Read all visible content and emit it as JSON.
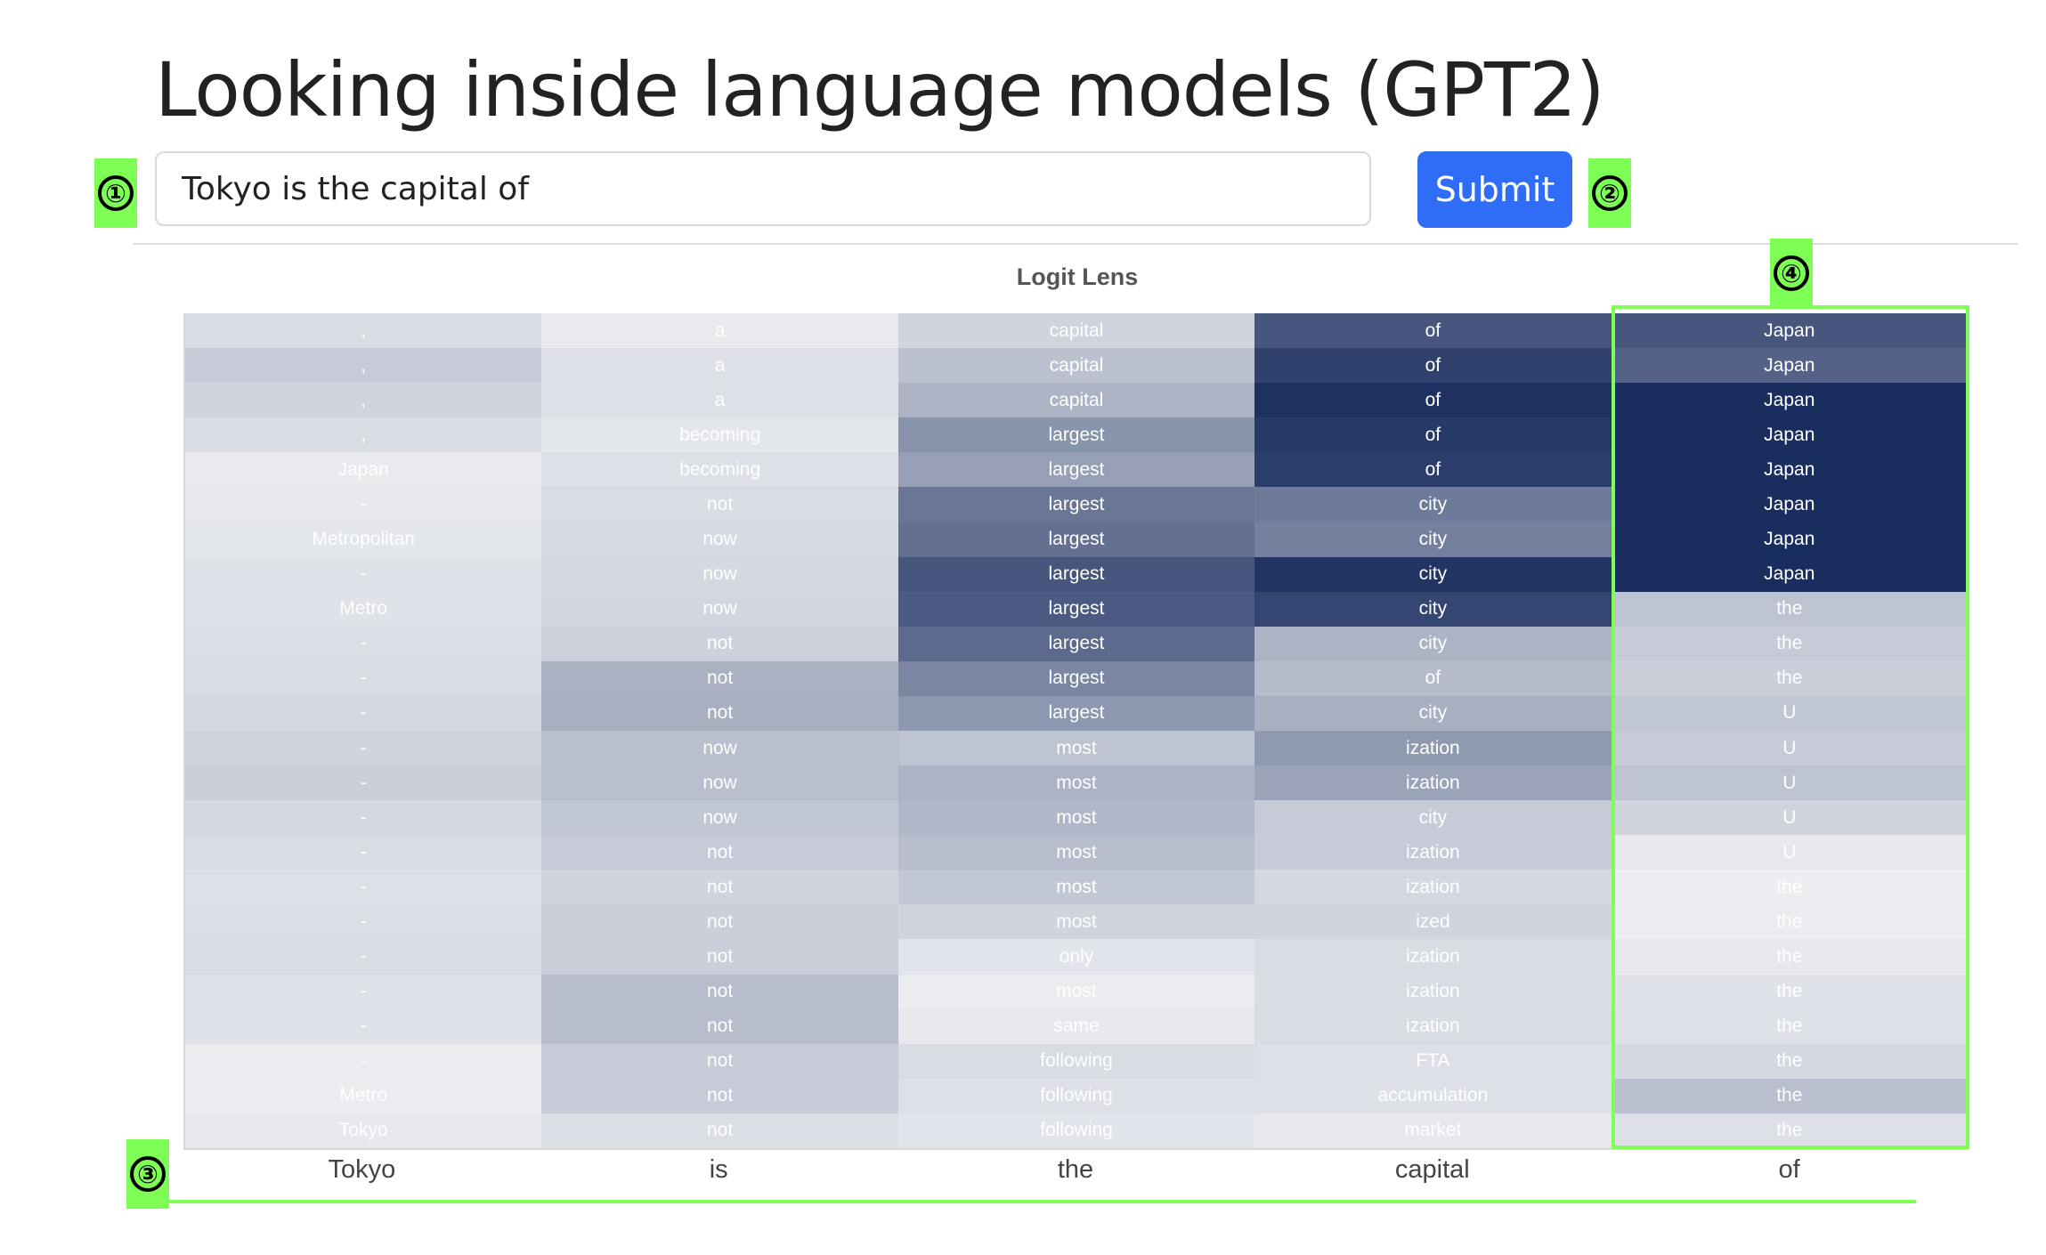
{
  "page_title": "Looking inside language models (GPT2)",
  "prompt": {
    "value": "Tokyo is the capital of"
  },
  "submit_label": "Submit",
  "annotations": [
    "①",
    "②",
    "③",
    "④"
  ],
  "colors": {
    "accent": "#2f6df6",
    "annotation": "#7dff55",
    "cell_base": "#15295b",
    "cell_light": "#f3f4f6"
  },
  "chart_data": {
    "type": "heatmap",
    "title": "Logit Lens",
    "columns": [
      "Tokyo",
      "is",
      "the",
      "capital",
      "of"
    ],
    "rows": [
      [
        ",",
        "a",
        "capital",
        "of",
        "Japan"
      ],
      [
        ",",
        "a",
        "capital",
        "of",
        "Japan"
      ],
      [
        ",",
        "a",
        "capital",
        "of",
        "Japan"
      ],
      [
        ",",
        "becoming",
        "largest",
        "of",
        "Japan"
      ],
      [
        "Japan",
        "becoming",
        "largest",
        "of",
        "Japan"
      ],
      [
        "-",
        "not",
        "largest",
        "city",
        "Japan"
      ],
      [
        "Metropolitan",
        "now",
        "largest",
        "city",
        "Japan"
      ],
      [
        "-",
        "now",
        "largest",
        "city",
        "Japan"
      ],
      [
        "Metro",
        "now",
        "largest",
        "city",
        "the"
      ],
      [
        "-",
        "not",
        "largest",
        "city",
        "the"
      ],
      [
        "-",
        "not",
        "largest",
        "of",
        "the"
      ],
      [
        "-",
        "not",
        "largest",
        "city",
        "U"
      ],
      [
        "-",
        "now",
        "most",
        "ization",
        "U"
      ],
      [
        "-",
        "now",
        "most",
        "ization",
        "U"
      ],
      [
        "-",
        "now",
        "most",
        "city",
        "U"
      ],
      [
        "-",
        "not",
        "most",
        "ization",
        "U"
      ],
      [
        "-",
        "not",
        "most",
        "ization",
        "the"
      ],
      [
        "-",
        "not",
        "most",
        "ized",
        "the"
      ],
      [
        "-",
        "not",
        "only",
        "ization",
        "the"
      ],
      [
        "-",
        "not",
        "most",
        "ization",
        "the"
      ],
      [
        "-",
        "not",
        "same",
        "ization",
        "the"
      ],
      [
        "-",
        "not",
        "following",
        "FTA",
        "the"
      ],
      [
        "Metro",
        "not",
        "following",
        "accumulation",
        "the"
      ],
      [
        "Tokyo",
        "not",
        "following",
        "market",
        "the"
      ]
    ],
    "intensity": [
      [
        0.12,
        0.05,
        0.16,
        0.78,
        0.78
      ],
      [
        0.2,
        0.1,
        0.25,
        0.88,
        0.72
      ],
      [
        0.16,
        0.1,
        0.32,
        0.96,
        0.98
      ],
      [
        0.12,
        0.07,
        0.48,
        0.92,
        0.98
      ],
      [
        0.05,
        0.1,
        0.42,
        0.9,
        0.98
      ],
      [
        0.06,
        0.12,
        0.62,
        0.6,
        0.98
      ],
      [
        0.07,
        0.13,
        0.65,
        0.57,
        0.98
      ],
      [
        0.09,
        0.14,
        0.78,
        0.94,
        0.98
      ],
      [
        0.09,
        0.15,
        0.76,
        0.86,
        0.24
      ],
      [
        0.11,
        0.17,
        0.68,
        0.32,
        0.2
      ],
      [
        0.12,
        0.33,
        0.54,
        0.28,
        0.18
      ],
      [
        0.14,
        0.34,
        0.46,
        0.34,
        0.22
      ],
      [
        0.16,
        0.26,
        0.24,
        0.45,
        0.2
      ],
      [
        0.18,
        0.26,
        0.32,
        0.4,
        0.24
      ],
      [
        0.14,
        0.22,
        0.3,
        0.2,
        0.16
      ],
      [
        0.12,
        0.2,
        0.27,
        0.2,
        0.06
      ],
      [
        0.1,
        0.16,
        0.22,
        0.14,
        0.03
      ],
      [
        0.11,
        0.18,
        0.16,
        0.16,
        0.04
      ],
      [
        0.12,
        0.18,
        0.08,
        0.12,
        0.06
      ],
      [
        0.09,
        0.27,
        0.04,
        0.12,
        0.09
      ],
      [
        0.09,
        0.27,
        0.06,
        0.12,
        0.1
      ],
      [
        0.04,
        0.2,
        0.12,
        0.1,
        0.14
      ],
      [
        0.04,
        0.2,
        0.1,
        0.1,
        0.26
      ],
      [
        0.06,
        0.11,
        0.08,
        0.06,
        0.1
      ]
    ],
    "xlabel": "",
    "ylabel": ""
  }
}
